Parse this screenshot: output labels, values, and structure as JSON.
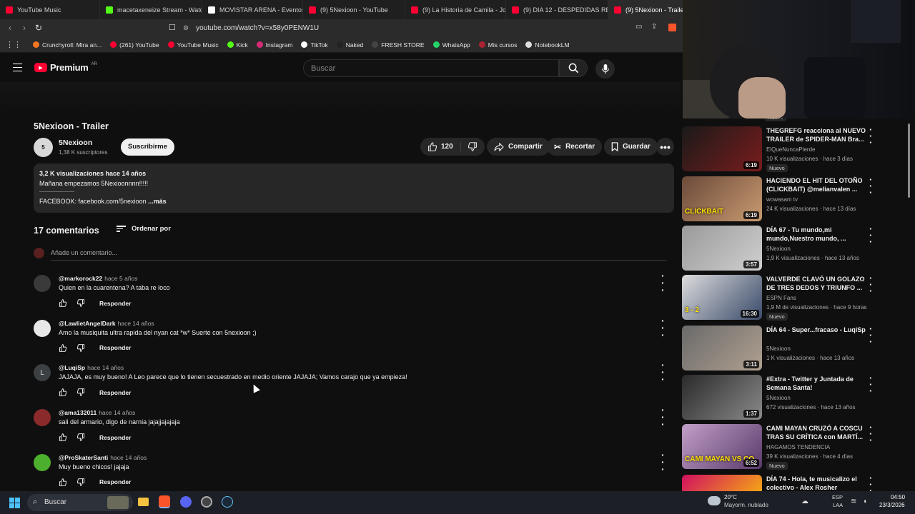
{
  "tabs": [
    {
      "label": "YouTube Music",
      "color": "#ff0033"
    },
    {
      "label": "macetaxeneize Stream - Watch",
      "color": "#53fc18"
    },
    {
      "label": "MOVISTAR ARENA - Eventos",
      "color": "#ffffff"
    },
    {
      "label": "(9) 5Nexioon - YouTube",
      "color": "#ff0033"
    },
    {
      "label": "(9) La Historia de Camila - Joa",
      "color": "#ff0033"
    },
    {
      "label": "(9) DIA 12 - DESPEDIDAS REC",
      "color": "#ff0033"
    },
    {
      "label": "(9) 5Nexioon - Trailer - Yo",
      "color": "#ff0033",
      "active": true
    }
  ],
  "address": {
    "url": "youtube.com/watch?v=x58y0PENW1U"
  },
  "bookmarks": [
    {
      "label": "Crunchyroll: Mira an...",
      "color": "#f47521"
    },
    {
      "label": "(261) YouTube",
      "color": "#ff0033"
    },
    {
      "label": "YouTube Music",
      "color": "#ff0033"
    },
    {
      "label": "Kick",
      "color": "#53fc18"
    },
    {
      "label": "Instagram",
      "color": "#d62976"
    },
    {
      "label": "TikTok",
      "color": "#ffffff"
    },
    {
      "label": "Naked",
      "color": "#222222"
    },
    {
      "label": "FRESH STORE",
      "color": "#444444"
    },
    {
      "label": "WhatsApp",
      "color": "#25d366"
    },
    {
      "label": "Mis cursos",
      "color": "#a23"
    },
    {
      "label": "NotebookLM",
      "color": "#dddddd"
    }
  ],
  "header": {
    "logo": "Premium",
    "region": "AR",
    "search_placeholder": "Buscar"
  },
  "video": {
    "title": "5Nexioon - Trailer",
    "channel": "5Nexioon",
    "subscribers": "1,38 K suscriptores",
    "subscribe_label": "Suscribirme",
    "likes": "120",
    "share_label": "Compartir",
    "clip_label": "Recortar",
    "save_label": "Guardar"
  },
  "description": {
    "stats": "3,2 K visualizaciones  hace 14 años",
    "line1": "Mañana empezamos 5Nexioonnnn!!!!!",
    "divider": "———————",
    "line2": "FACEBOOK: facebook.com/5nexioon",
    "more": "...más"
  },
  "comments_section": {
    "count_label": "17 comentarios",
    "sort_label": "Ordenar por",
    "add_placeholder": "Añade un comentario...",
    "reply_label": "Responder",
    "items": [
      {
        "author": "@markorock22",
        "time": "hace 5 años",
        "text": "Quien en la cuarentena? A taba re loco",
        "avatar_color": "#3a3a3a"
      },
      {
        "author": "@LawlietAngelDark",
        "time": "hace 14 años",
        "text": "Amo la  musiquita ultra rapida del nyan cat *w* Suerte con 5nexioon ;)",
        "avatar_color": "#e8e8e8"
      },
      {
        "author": "@LuqiSp",
        "time": "hace 14 años",
        "text": "JAJAJA, es muy bueno! A Leo parece que lo tienen secuestrado en medio oriente JAJAJA; Vamos carajo que ya empieza!",
        "avatar_color": "#3c4043",
        "initial": "L"
      },
      {
        "author": "@ama132011",
        "time": "hace 14 años",
        "text": "sali del armario, digo de narnia jajajjajajaja",
        "avatar_color": "#8b2a2a"
      },
      {
        "author": "@ProSkaterSanti",
        "time": "hace 14 años",
        "text": "Muy bueno chicos! jajaja",
        "avatar_color": "#4caf2e"
      }
    ]
  },
  "sidebar": {
    "top_badge": "Nuevo",
    "videos": [
      {
        "title": "THEGREFG reacciona al NUEVO TRAILER de SPIDER-MAN Bra...",
        "channel": "ElQueNuncaPierde",
        "meta": "10 K visualizaciones · hace 3 días",
        "duration": "6:19",
        "badge": "Nuevo",
        "colors": [
          "#1a1a1a",
          "#7a1c1c"
        ]
      },
      {
        "title": "HACIENDO EL HIT DEL OTOÑO (CLICKBAIT) @melianvalen ...",
        "channel": "wowasam tv",
        "meta": "24 K visualizaciones · hace 13 días",
        "duration": "6:19",
        "thumb_text": "CLICKBAIT",
        "colors": [
          "#6b4a3a",
          "#c89a70"
        ]
      },
      {
        "title": "DÍA 67 - Tu mundo,mi mundo,Nuestro mundo, ...",
        "channel": "5Nexioon",
        "meta": "1,9 K visualizaciones · hace 13 años",
        "duration": "3:57",
        "colors": [
          "#9a9a9a",
          "#cfcfcf"
        ]
      },
      {
        "title": "VALVERDE CLAVÓ UN GOLAZO DE TRES DEDOS Y TRIUNFO ...",
        "channel": "ESPN Fans",
        "meta": "1,9 M de visualizaciones · hace 9 horas",
        "duration": "16:30",
        "badge": "Nuevo",
        "thumb_text": "3 - 2",
        "colors": [
          "#dcdcdc",
          "#3a4a6a"
        ]
      },
      {
        "title": "DÍA 64 - Super...fracaso - LuqiSp",
        "channel": "5Nexioon",
        "meta": "1 K visualizaciones · hace 13 años",
        "duration": "3:11",
        "colors": [
          "#6a6a6a",
          "#b0a090"
        ]
      },
      {
        "title": "#Extra - Twitter y Juntada de Semana Santa!",
        "channel": "5Nexioon",
        "meta": "672 visualizaciones · hace 13 años",
        "duration": "1:37",
        "colors": [
          "#2a2a2a",
          "#8a8a8a"
        ]
      },
      {
        "title": "CAMI MAYAN CRUZÓ A COSCU TRAS SU CRÍTICA con MARTÍ...",
        "channel": "HAGAMOS TENDENCIA",
        "meta": "39 K visualizaciones · hace 4 días",
        "duration": "6:52",
        "badge": "Nuevo",
        "thumb_text": "CAMI MAYAN VS CO",
        "colors": [
          "#c0a0c8",
          "#5a3a6a"
        ]
      },
      {
        "title": "DÍA 74 - Hola, te musicalizo el colectivo - Alex Rosher",
        "channel": "",
        "meta": "",
        "duration": "",
        "thumb_text": "MÚSICA",
        "colors": [
          "#d01060",
          "#ffd000"
        ]
      }
    ]
  },
  "taskbar": {
    "search_label": "Buscar",
    "weather_temp": "20°C",
    "weather_desc": "Mayorm. nublado",
    "lang1": "ESP",
    "lang2": "LAA",
    "time": "04:50",
    "date": "23/3/2026"
  }
}
